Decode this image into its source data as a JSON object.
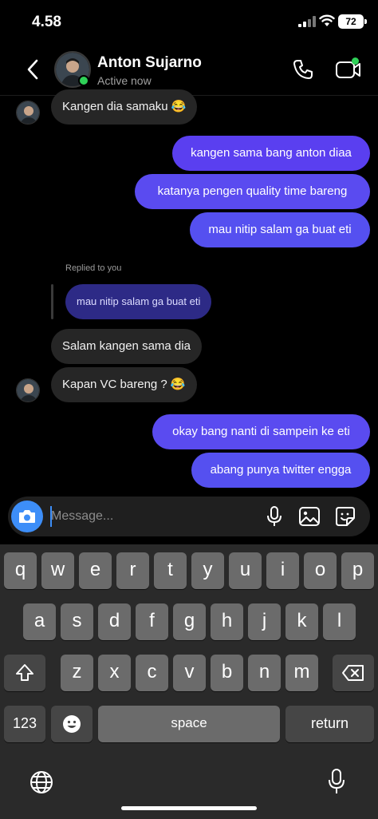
{
  "status_bar": {
    "time": "4.58",
    "battery": "72"
  },
  "header": {
    "name": "Anton Sujarno",
    "status": "Active now"
  },
  "messages": {
    "m1": "Kangen dia samaku 😂",
    "m2": "kangen sama bang anton diaa",
    "m3": "katanya pengen  quality time bareng",
    "m4": "mau nitip salam ga buat eti",
    "replied_label": "Replied to you",
    "reply_quote": "mau nitip salam ga buat eti",
    "m5": "Salam kangen sama dia",
    "m6": "Kapan VC bareng ? 😂",
    "m7": "okay bang nanti di sampein ke eti",
    "m8": "abang punya twitter engga"
  },
  "composer": {
    "placeholder": "Message..."
  },
  "keyboard": {
    "row1": [
      "q",
      "w",
      "e",
      "r",
      "t",
      "y",
      "u",
      "i",
      "o",
      "p"
    ],
    "row2": [
      "a",
      "s",
      "d",
      "f",
      "g",
      "h",
      "j",
      "k",
      "l"
    ],
    "row3": [
      "z",
      "x",
      "c",
      "v",
      "b",
      "n",
      "m"
    ],
    "numbers_label": "123",
    "space_label": "space",
    "return_label": "return"
  },
  "colors": {
    "sent_bubble": "#5b46f1",
    "received_bubble": "#262626",
    "accent": "#3d8ef8",
    "online": "#2fd158"
  }
}
